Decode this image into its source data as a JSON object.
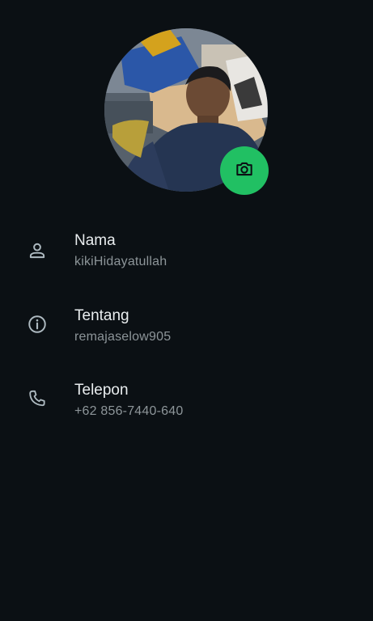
{
  "colors": {
    "background": "#0b1014",
    "accent": "#21c063",
    "primary_text": "#e9edef",
    "secondary_text": "#8d9599",
    "icon": "#aebac1"
  },
  "profile": {
    "photo_icon": "profile-photo",
    "camera_icon": "camera-icon"
  },
  "fields": [
    {
      "icon": "person-icon",
      "label": "Nama",
      "value": "kikiHidayatullah"
    },
    {
      "icon": "info-icon",
      "label": "Tentang",
      "value": "remajaselow905"
    },
    {
      "icon": "phone-icon",
      "label": "Telepon",
      "value": "+62 856-7440-640"
    }
  ]
}
